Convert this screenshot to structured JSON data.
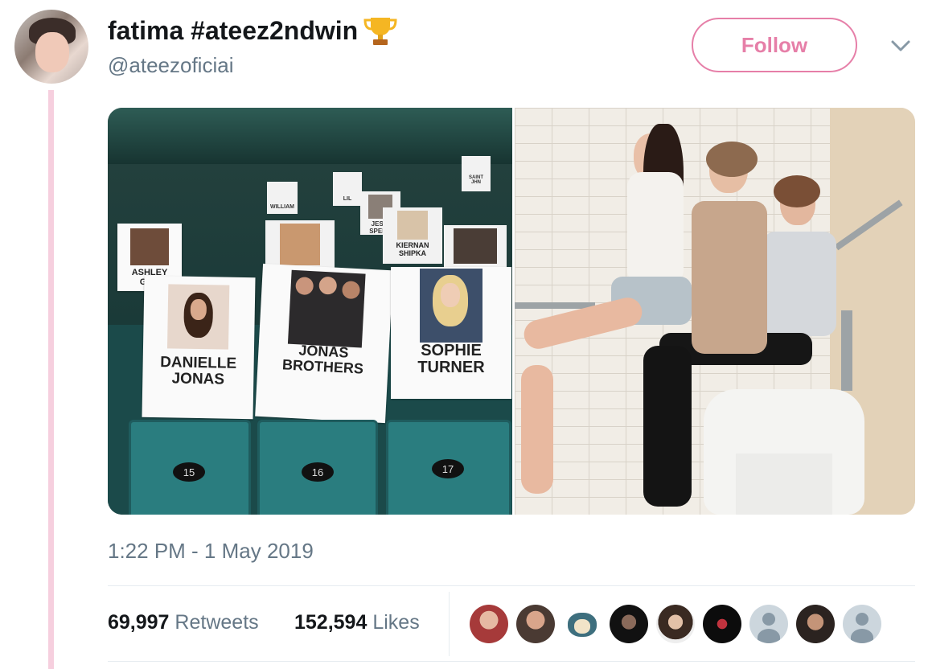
{
  "tweet": {
    "display_name": "fatima #ateez2ndwin",
    "display_name_emoji": "trophy-icon",
    "handle": "@ateezoficiai",
    "follow_label": "Follow",
    "timestamp": "1:22 PM - 1 May 2019"
  },
  "media": {
    "left_image": {
      "cards": [
        {
          "name": "DANIELLE\nJONAS"
        },
        {
          "name": "JONAS\nBROTHERS"
        },
        {
          "name": "SOPHIE\nTURNER"
        },
        {
          "name": "ASHLEY\nGRA"
        },
        {
          "name": "KIERNAN\nSHIPKA"
        },
        {
          "name": "JESSI\nSPENC"
        },
        {
          "name": "WILLIAM"
        },
        {
          "name": "SAINT\nJHN"
        },
        {
          "name": "LIL"
        }
      ],
      "seat_numbers": [
        "15",
        "16",
        "17"
      ]
    }
  },
  "stats": {
    "retweets_count": "69,997",
    "retweets_label": "Retweets",
    "likes_count": "152,594",
    "likes_label": "Likes"
  },
  "likers": [
    {
      "icon": "user-avatar-1"
    },
    {
      "icon": "user-avatar-2"
    },
    {
      "icon": "snorlax-avatar"
    },
    {
      "icon": "user-avatar-4"
    },
    {
      "icon": "user-avatar-5"
    },
    {
      "icon": "user-avatar-6"
    },
    {
      "icon": "default-avatar-icon"
    },
    {
      "icon": "user-avatar-8"
    },
    {
      "icon": "default-avatar-icon"
    }
  ],
  "colors": {
    "follow": "#e67fa8",
    "thread_line": "#f6cfde",
    "secondary_text": "#657786"
  }
}
